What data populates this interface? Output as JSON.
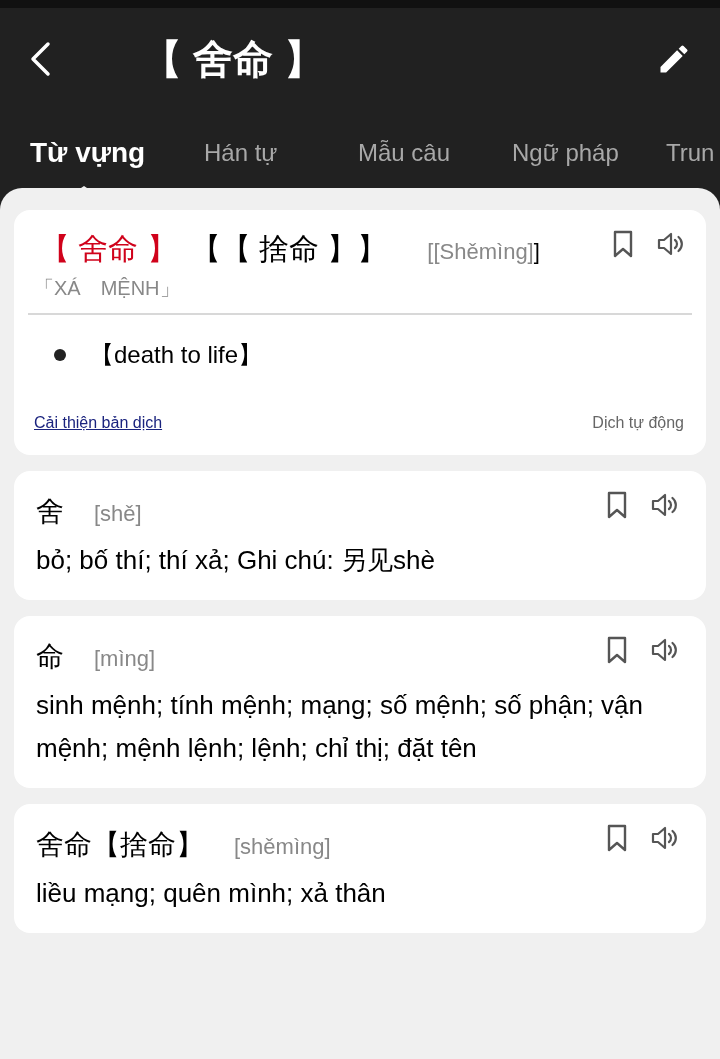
{
  "header": {
    "title": "【 舍命 】"
  },
  "tabs": [
    {
      "label": "Từ vựng",
      "selected": true
    },
    {
      "label": "Hán tự",
      "selected": false
    },
    {
      "label": "Mẫu câu",
      "selected": false
    },
    {
      "label": "Ngữ pháp",
      "selected": false
    },
    {
      "label": "Trun",
      "selected": false
    }
  ],
  "main_entry": {
    "word": "【 舍命 】",
    "variant": "【【 捨命 】】",
    "pinyin": "[[Shěmìng]",
    "pinyin_close": "]",
    "han_viet": "「XÁ　MỆNH」",
    "meanings": [
      "【death to life】"
    ],
    "improve_link": "Cải thiện bản dịch",
    "auto_note": "Dịch tự động"
  },
  "entries": [
    {
      "word": "舍",
      "pinyin": "[shě]",
      "meaning": "bỏ; bố thí; thí xả; Ghi chú: 另见shè"
    },
    {
      "word": "命",
      "pinyin": "[mìng]",
      "meaning": "sinh mệnh; tính mệnh; mạng; số mệnh; số phận; vận mệnh; mệnh lệnh; lệnh; chỉ thị; đặt tên"
    },
    {
      "word": "舍命【捨命】",
      "pinyin": "[shěmìng]",
      "meaning": "liều mạng; quên mình; xả thân"
    }
  ]
}
